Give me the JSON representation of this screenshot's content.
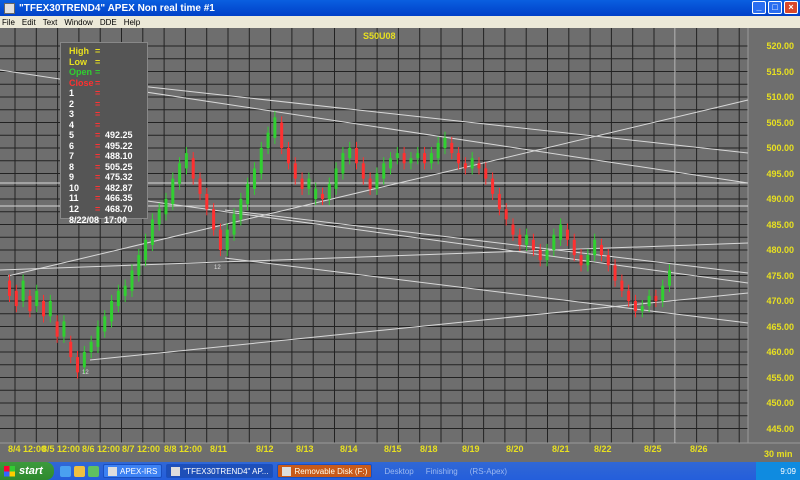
{
  "window": {
    "title": "\"TFEX30TREND4\" APEX Non real time #1"
  },
  "menu": [
    "File",
    "Edit",
    "Text",
    "Window",
    "DDE",
    "Help"
  ],
  "chart": {
    "symbol": "S50U08",
    "interval": "30 min",
    "price_labels": [
      "520.00",
      "515.00",
      "510.00",
      "505.00",
      "500.00",
      "495.00",
      "490.00",
      "485.00",
      "480.00",
      "475.00",
      "470.00",
      "465.00",
      "460.00",
      "455.00",
      "450.00",
      "445.00"
    ],
    "date_labels": [
      "8/4 12:00",
      "8/5 12:00",
      "8/6 12:00",
      "8/7 12:00",
      "8/8 12:00",
      "8/11",
      "8/12",
      "8/13",
      "8/14",
      "8/15",
      "8/18",
      "8/19",
      "8/20",
      "8/21",
      "8/22",
      "8/25",
      "8/26"
    ],
    "marker_labels": [
      "12",
      "12"
    ]
  },
  "info_box": {
    "high": {
      "label": "High",
      "eq": "=",
      "value": ""
    },
    "low": {
      "label": "Low",
      "eq": "=",
      "value": ""
    },
    "open": {
      "label": "Open",
      "eq": "=",
      "value": ""
    },
    "close": {
      "label": "Close",
      "eq": "=",
      "value": ""
    },
    "levels": [
      {
        "k": "1",
        "v": ""
      },
      {
        "k": "2",
        "v": ""
      },
      {
        "k": "3",
        "v": ""
      },
      {
        "k": "4",
        "v": ""
      },
      {
        "k": "5",
        "v": "492.25"
      },
      {
        "k": "6",
        "v": "495.22"
      },
      {
        "k": "7",
        "v": "488.10"
      },
      {
        "k": "8",
        "v": "505.25"
      },
      {
        "k": "9",
        "v": "475.32"
      },
      {
        "k": "10",
        "v": "482.87"
      },
      {
        "k": "11",
        "v": "466.35"
      },
      {
        "k": "12",
        "v": "468.70"
      }
    ],
    "date": "8/22/08",
    "time": "17:00"
  },
  "taskbar": {
    "start": "start",
    "tasks": [
      "APEX-IRS",
      "\"TFEX30TREND4\" AP...",
      "Removable Disk (F:)"
    ],
    "tray": [
      "Desktop",
      "Finishing",
      "(RS-Apex)"
    ],
    "clock": "9:09"
  },
  "colors": {
    "up": "#30d030",
    "down": "#ff3030",
    "accent": "#e8e020",
    "chart_bg": "#6e6e6e"
  },
  "candles": [
    [
      474,
      471
    ],
    [
      472,
      469
    ],
    [
      470,
      474
    ],
    [
      471,
      468
    ],
    [
      469,
      472
    ],
    [
      470,
      467
    ],
    [
      467,
      470
    ],
    [
      466,
      463
    ],
    [
      463,
      466
    ],
    [
      462,
      459
    ],
    [
      459,
      456
    ],
    [
      457,
      460
    ],
    [
      460,
      462
    ],
    [
      461,
      465
    ],
    [
      464,
      467
    ],
    [
      466,
      470
    ],
    [
      469,
      472
    ],
    [
      471,
      473
    ],
    [
      472,
      476
    ],
    [
      475,
      479
    ],
    [
      478,
      482
    ],
    [
      481,
      486
    ],
    [
      485,
      488
    ],
    [
      487,
      490
    ],
    [
      489,
      494
    ],
    [
      493,
      497
    ],
    [
      496,
      499
    ],
    [
      498,
      494
    ],
    [
      494,
      491
    ],
    [
      491,
      488
    ],
    [
      488,
      484
    ],
    [
      484,
      480
    ],
    [
      480,
      484
    ],
    [
      483,
      487
    ],
    [
      486,
      490
    ],
    [
      489,
      493
    ],
    [
      492,
      496
    ],
    [
      495,
      500
    ],
    [
      500,
      503
    ],
    [
      502,
      506
    ],
    [
      505,
      500
    ],
    [
      500,
      497
    ],
    [
      497,
      494
    ],
    [
      494,
      492
    ],
    [
      492,
      494
    ],
    [
      490,
      492
    ],
    [
      491,
      490
    ],
    [
      490,
      493
    ],
    [
      492,
      496
    ],
    [
      495,
      499
    ],
    [
      498,
      500
    ],
    [
      500,
      497
    ],
    [
      497,
      494
    ],
    [
      494,
      492
    ],
    [
      492,
      495
    ],
    [
      494,
      497
    ],
    [
      496,
      498
    ],
    [
      498,
      499
    ],
    [
      499,
      497
    ],
    [
      497,
      498
    ],
    [
      498,
      499
    ],
    [
      499,
      497
    ],
    [
      497,
      499
    ],
    [
      498,
      501
    ],
    [
      500,
      502
    ],
    [
      501,
      499
    ],
    [
      499,
      497
    ],
    [
      497,
      496
    ],
    [
      496,
      498
    ],
    [
      497,
      496
    ],
    [
      496,
      494
    ],
    [
      494,
      491
    ],
    [
      491,
      488
    ],
    [
      488,
      486
    ],
    [
      485,
      483
    ],
    [
      483,
      481
    ],
    [
      481,
      483
    ],
    [
      482,
      480
    ],
    [
      480,
      478
    ],
    [
      478,
      480
    ],
    [
      480,
      483
    ],
    [
      482,
      485
    ],
    [
      484,
      482
    ],
    [
      482,
      479
    ],
    [
      479,
      477
    ],
    [
      477,
      479
    ],
    [
      479,
      482
    ],
    [
      481,
      479
    ],
    [
      479,
      477
    ],
    [
      477,
      474
    ],
    [
      474,
      472
    ],
    [
      472,
      470
    ],
    [
      470,
      468
    ],
    [
      468,
      469
    ],
    [
      469,
      471
    ],
    [
      471,
      470
    ],
    [
      470,
      473
    ],
    [
      473,
      476
    ]
  ]
}
